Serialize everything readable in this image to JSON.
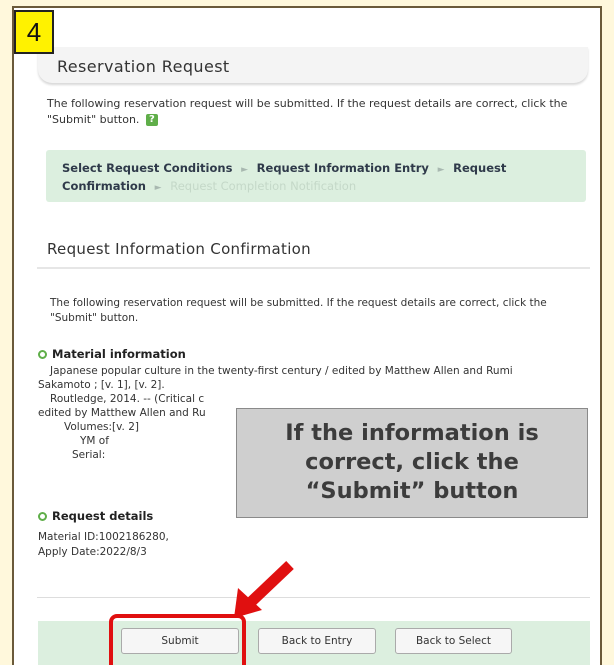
{
  "step_number": "4",
  "page_title": "Reservation Request",
  "intro_text": "The following reservation request will be submitted. If the request details are correct, click the \"Submit\" button.",
  "help_icon_label": "?",
  "steps": [
    {
      "label": "Select Request Conditions",
      "state": "done"
    },
    {
      "label": "Request Information Entry",
      "state": "done"
    },
    {
      "label": "Request Confirmation",
      "state": "current"
    },
    {
      "label": "Request Completion Notification",
      "state": "pending"
    }
  ],
  "step_separator": "►",
  "section_title": "Request Information Confirmation",
  "confirm_intro": "The following reservation request will be submitted. If the request details are correct, click the \"Submit\" button.",
  "material": {
    "heading": "Material information",
    "title_line1": "Japanese popular culture in the twenty-first century / edited by Matthew Allen and Rumi",
    "title_line2": "Sakamoto ; [v. 1], [v. 2].",
    "publisher_line": "Routledge, 2014. -- (Critical c",
    "editor_line": "edited by Matthew Allen and Ru",
    "volumes_line": "Volumes:[v. 2]",
    "ym_line": "YM of",
    "serial_line": "Serial:"
  },
  "request_details": {
    "heading": "Request details",
    "material_id_line": "Material ID:1002186280,",
    "apply_date_line": "Apply Date:2022/8/3"
  },
  "buttons": {
    "submit": "Submit",
    "back_to_entry": "Back to Entry",
    "back_to_select": "Back to Select"
  },
  "callout": {
    "line1": "If the information is",
    "line2": "correct, click the",
    "line3": "“Submit” button"
  },
  "colors": {
    "badge": "#fff200",
    "accent_green": "#5fae49",
    "step_bar": "#dcefdf",
    "highlight": "#e01010",
    "callout_bg": "#cfcfcf"
  }
}
